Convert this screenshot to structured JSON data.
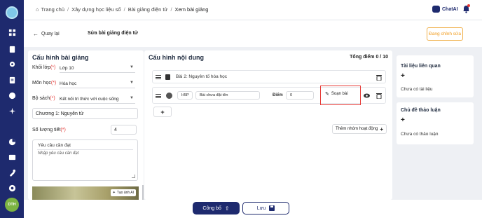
{
  "colors": {
    "sidebar": "#1e2a6e",
    "accent": "#1e2a6e",
    "warning": "#f09a1a",
    "highlight": "#e53935"
  },
  "sidebar": {
    "icons": [
      "grid-icon",
      "layers-icon",
      "calendar-icon",
      "location-icon",
      "document-icon",
      "chat-icon",
      "sparkle-icon",
      "chart-icon",
      "book-icon",
      "tools-icon",
      "settings-icon"
    ],
    "avatar": "DTH"
  },
  "breadcrumb": [
    "Trang chủ",
    "Xây dựng học liệu số",
    "Bài giảng điện tử",
    "Xem bài giảng"
  ],
  "topbar": {
    "chatai_label": "ChatAI"
  },
  "header": {
    "back_label": "Quay lại",
    "title": "Sửa bài giảng điện tử",
    "status_label": "Đang chỉnh sửa"
  },
  "config": {
    "title": "Cấu hình bài giảng",
    "grade": {
      "label": "Khối lớp",
      "required_mark": "(*)",
      "value": "Lớp 10"
    },
    "subject": {
      "label": "Môn học",
      "required_mark": "(*)",
      "value": "Hóa học"
    },
    "book": {
      "label": "Bộ sách",
      "required_mark": "(*)",
      "value": "Kết nối tri thức với cuộc sống"
    },
    "chapter": {
      "value": "Chương 1: Nguyên tử"
    },
    "periods": {
      "label": "Số lượng tiết",
      "required_mark": "(*)",
      "value": "4"
    },
    "requirements": {
      "label": "Yêu cầu cần đạt",
      "placeholder": "Nhập yêu cầu cần đạt"
    },
    "ai_image_label": "Tạo ảnh AI"
  },
  "content": {
    "title": "Cấu hình nội dung",
    "total_label": "Tổng điểm 0 / 10",
    "lesson_title": "Bài 2: Nguyên tố hóa học",
    "activity": {
      "type": "H5P",
      "name": "Bài chưa đặt tên",
      "score_label": "Điểm",
      "score_value": "0",
      "edit_label": "Soạn bài"
    },
    "add_symbol": "+",
    "add_group_label": "Thêm nhóm hoạt động"
  },
  "resources": {
    "title": "Tài liệu liên quan",
    "add_symbol": "+",
    "empty": "Chưa có tài liệu"
  },
  "discussion": {
    "title": "Chủ đề thảo luận",
    "add_symbol": "+",
    "empty": "Chưa có thảo luận"
  },
  "footer": {
    "publish_label": "Công bố",
    "save_label": "Lưu"
  }
}
